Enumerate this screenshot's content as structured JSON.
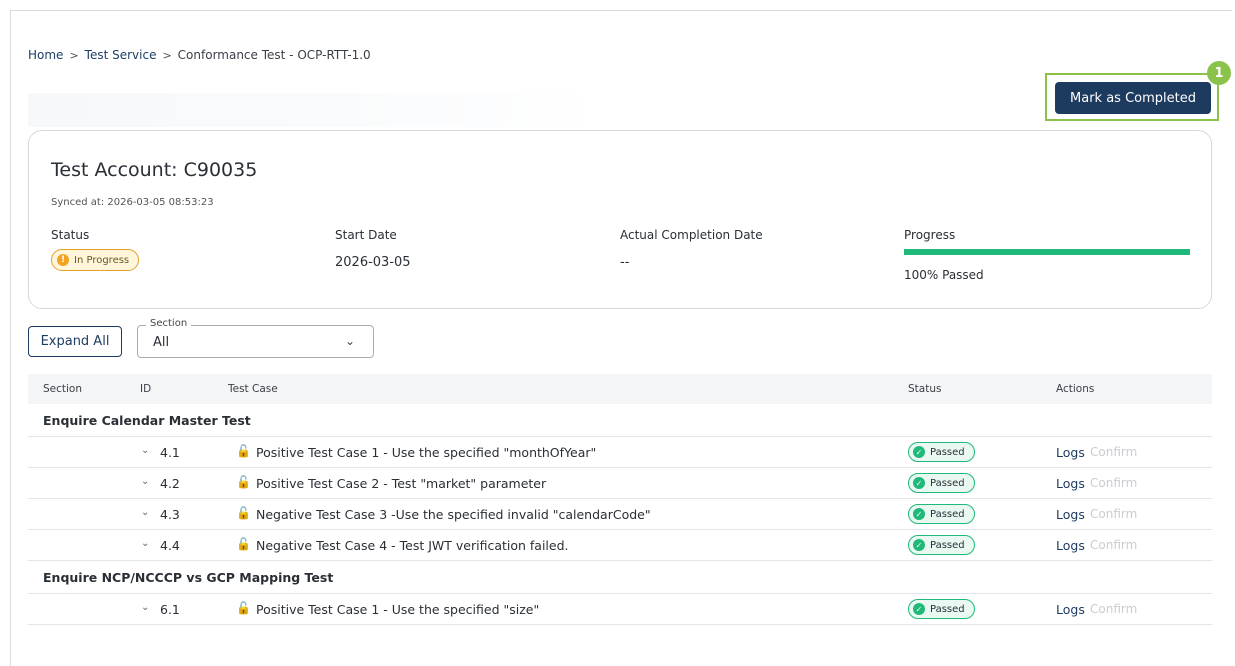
{
  "breadcrumb": {
    "home": "Home",
    "sep": ">",
    "service": "Test Service",
    "current": "Conformance Test - OCP-RTT-1.0"
  },
  "actions": {
    "mark_completed": "Mark as Completed",
    "step_badge": "1"
  },
  "account": {
    "title": "Test Account: C90035",
    "synced": "Synced at: 2026-03-05 08:53:23",
    "status_label": "Status",
    "status_value": "In Progress",
    "start_label": "Start Date",
    "start_value": "2026-03-05",
    "completion_label": "Actual Completion Date",
    "completion_value": "--",
    "progress_label": "Progress",
    "progress_text": "100% Passed",
    "progress_fraction": 1.0
  },
  "filters": {
    "expand_all": "Expand All",
    "section_label": "Section",
    "section_value": "All"
  },
  "table": {
    "headers": {
      "section": "Section",
      "id": "ID",
      "test_case": "Test Case",
      "status": "Status",
      "actions": "Actions"
    },
    "groups": [
      {
        "name": "Enquire Calendar Master Test",
        "rows": [
          {
            "id": "4.1",
            "case": "Positive Test Case 1 - Use the specified \"monthOfYear\"",
            "status": "Passed",
            "logs": "Logs",
            "confirm": "Confirm"
          },
          {
            "id": "4.2",
            "case": "Positive Test Case 2 - Test \"market\" parameter",
            "status": "Passed",
            "logs": "Logs",
            "confirm": "Confirm"
          },
          {
            "id": "4.3",
            "case": "Negative Test Case 3 -Use the specified invalid \"calendarCode\"",
            "status": "Passed",
            "logs": "Logs",
            "confirm": "Confirm"
          },
          {
            "id": "4.4",
            "case": "Negative Test Case 4 - Test JWT verification failed.",
            "status": "Passed",
            "logs": "Logs",
            "confirm": "Confirm"
          }
        ]
      },
      {
        "name": "Enquire NCP/NCCCP vs GCP Mapping Test",
        "rows": [
          {
            "id": "6.1",
            "case": "Positive Test Case 1 - Use the specified \"size\"",
            "status": "Passed",
            "logs": "Logs",
            "confirm": "Confirm"
          }
        ]
      }
    ]
  },
  "colors": {
    "primary": "#1d3a5f",
    "success": "#1fb97a",
    "warning": "#f3a31f",
    "highlight": "#8bc34a"
  }
}
